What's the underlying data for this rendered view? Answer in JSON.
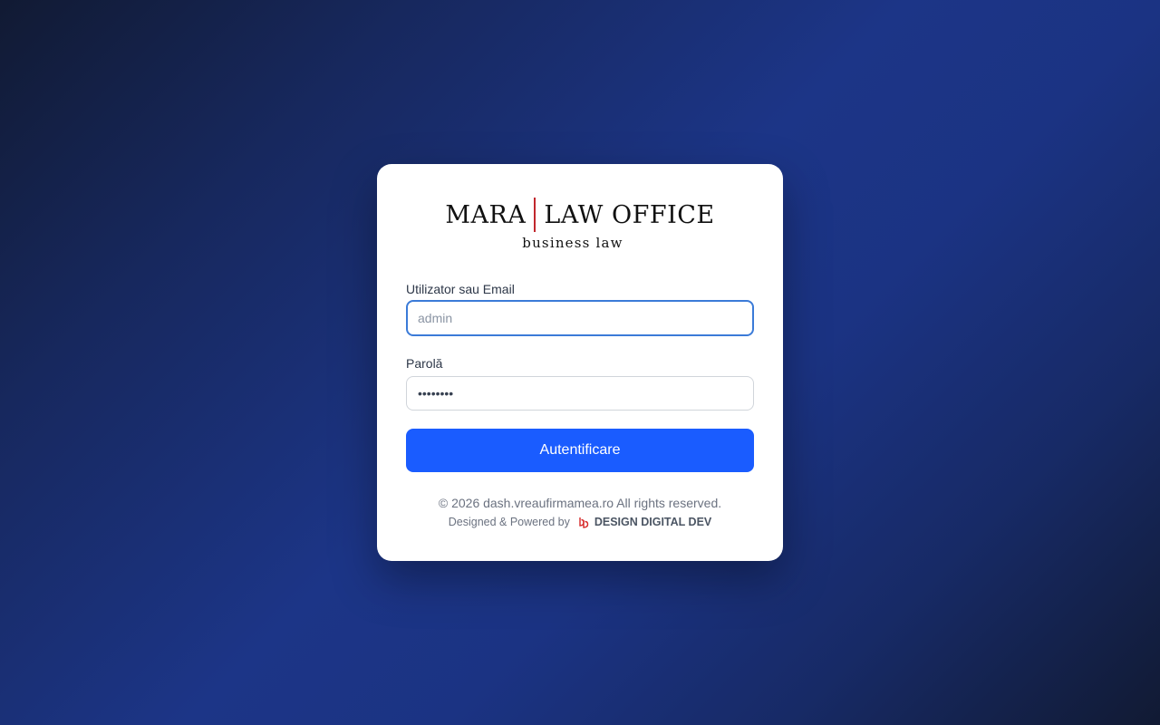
{
  "logo": {
    "left": "MARA",
    "right": "LAW OFFICE",
    "tagline": "business law",
    "divider_color": "#c1272d"
  },
  "form": {
    "username_label": "Utilizator sau Email",
    "username_placeholder": "admin",
    "password_label": "Parolă",
    "password_value": "••••••••",
    "submit_label": "Autentificare"
  },
  "footer": {
    "copyright": "© 2026 dash.vreaufirmamea.ro All rights reserved.",
    "powered_prefix": "Designed & Powered by",
    "powered_brand": "DESIGN DIGITAL DEV",
    "brand_icon": "design-digital-dev-logo-icon"
  },
  "colors": {
    "accent": "#1a5cff",
    "focus": "#3b7bd8",
    "brand_red": "#d62828"
  }
}
